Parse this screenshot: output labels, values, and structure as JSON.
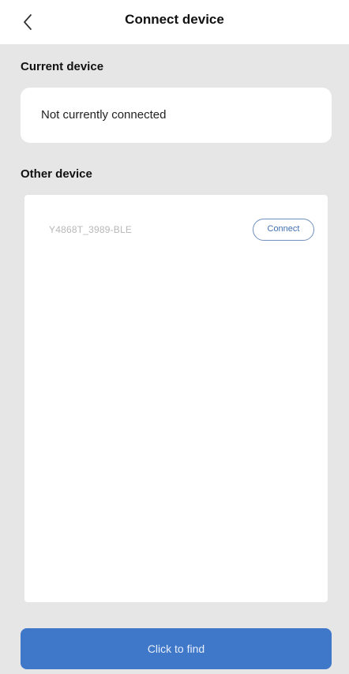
{
  "header": {
    "title": "Connect device",
    "back_icon": "chevron-left-icon"
  },
  "current_device": {
    "label": "Current device",
    "status_text": "Not currently connected"
  },
  "other_device": {
    "label": "Other device",
    "devices": [
      {
        "name": "Y4868T_3989-BLE",
        "action_label": "Connect"
      }
    ]
  },
  "footer": {
    "find_label": "Click to find"
  },
  "colors": {
    "background": "#e6e6e6",
    "card": "#ffffff",
    "primary": "#3f77c9",
    "connect_border": "#6f8fbd",
    "device_name_text": "#b8b8b8"
  }
}
